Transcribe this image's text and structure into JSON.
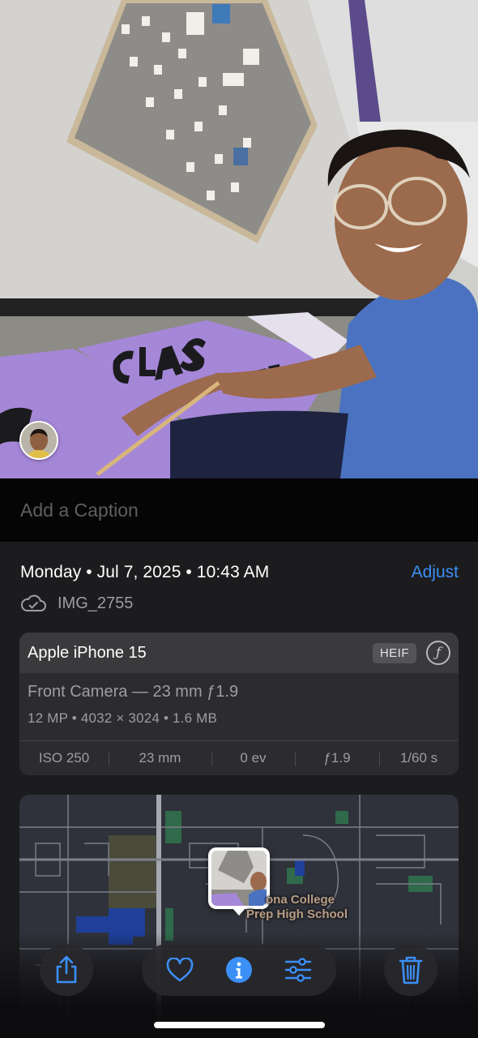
{
  "caption": {
    "placeholder": "Add a Caption"
  },
  "info": {
    "date_text": "Monday • Jul 7, 2025 • 10:43 AM",
    "adjust_label": "Adjust",
    "file_name": "IMG_2755",
    "cloud_icon": "icloud-check-icon"
  },
  "camera": {
    "device": "Apple iPhone 15",
    "format_badge": "HEIF",
    "aperture_icon": "f-stop-icon",
    "lens": "Front Camera — 23 mm ƒ1.9",
    "specs": "12 MP • 4032 × 3024 • 1.6 MB",
    "stats": [
      "ISO 250",
      "23 mm",
      "0 ev",
      "ƒ1.9",
      "1/60 s"
    ]
  },
  "map": {
    "place_line1": "ona College",
    "place_line2": "Prep High School"
  },
  "toolbar": {
    "share_icon": "share-icon",
    "favorite_icon": "heart-icon",
    "info_icon": "info-icon",
    "edit_icon": "sliders-icon",
    "delete_icon": "trash-icon"
  },
  "colors": {
    "accent": "#3b8ff5",
    "panel_bg": "#1c1c1e",
    "card_bg": "#2c2c2e",
    "secondary_text": "#9d9da3",
    "banner_purple": "#a587d8",
    "shirt_blue": "#4a72c0"
  }
}
